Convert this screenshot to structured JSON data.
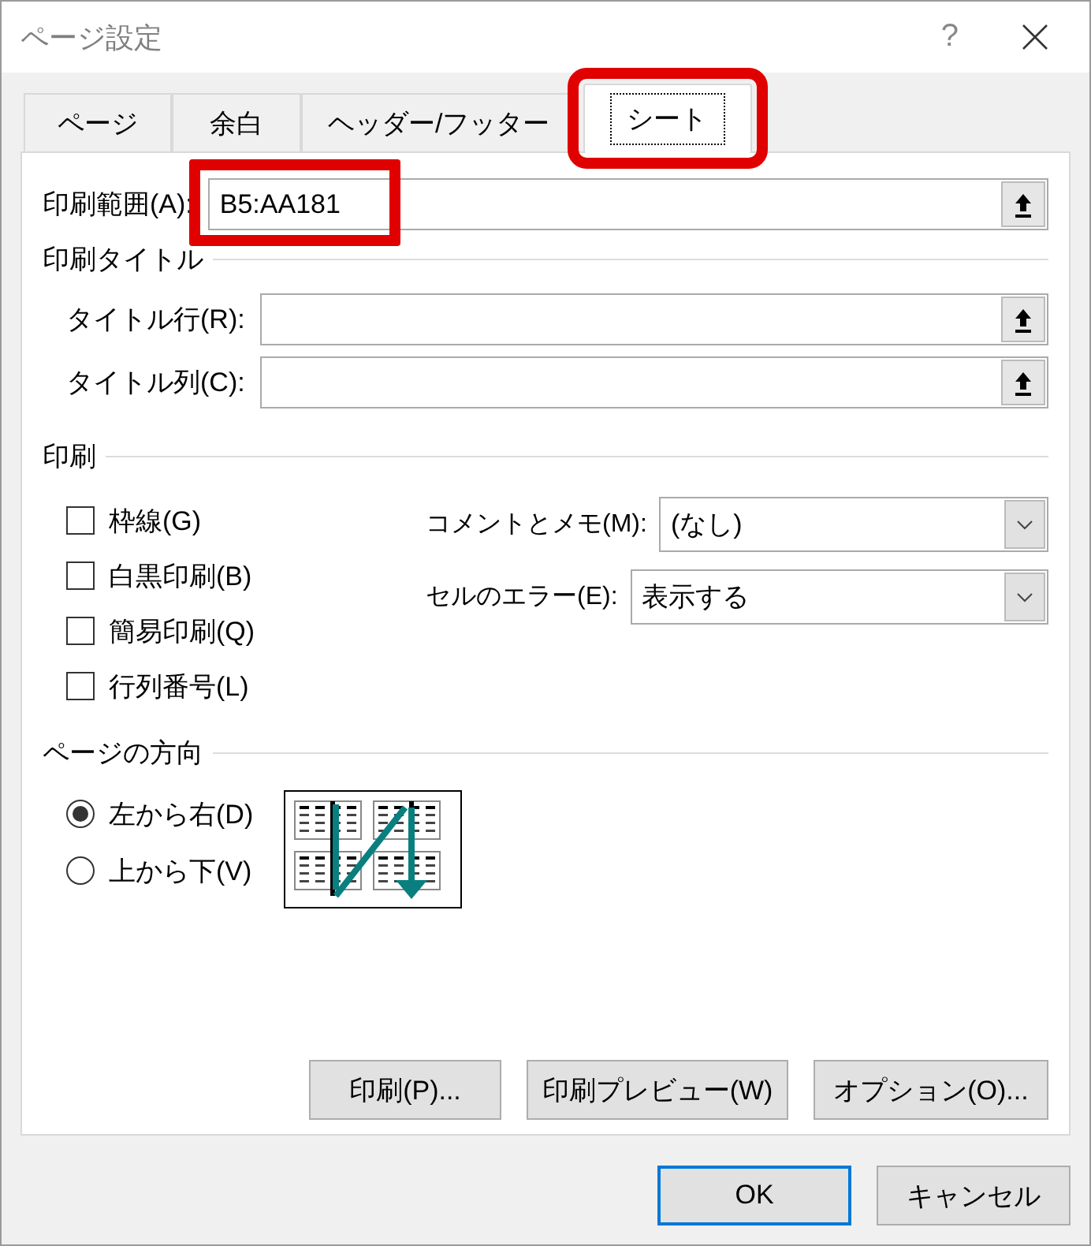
{
  "window": {
    "title": "ページ設定",
    "help": "?"
  },
  "tabs": [
    {
      "label": "ページ",
      "selected": false,
      "highlighted": false
    },
    {
      "label": "余白",
      "selected": false,
      "highlighted": false
    },
    {
      "label": "ヘッダー/フッター",
      "selected": false,
      "highlighted": false
    },
    {
      "label": "シート",
      "selected": true,
      "highlighted": true
    }
  ],
  "print_area": {
    "label": "印刷範囲(A):",
    "value": "B5:AA181",
    "highlighted": true
  },
  "print_titles": {
    "heading": "印刷タイトル",
    "fields": [
      {
        "label": "タイトル行(R):"
      },
      {
        "label": "タイトル列(C):"
      }
    ]
  },
  "print": {
    "heading": "印刷",
    "options": [
      {
        "label": "枠線(G)",
        "checked": false
      },
      {
        "label": "白黒印刷(B)",
        "checked": false
      },
      {
        "label": "簡易印刷(Q)",
        "checked": false
      },
      {
        "label": "行列番号(L)",
        "checked": false
      }
    ],
    "dropdowns": [
      {
        "label": "コメントとメモ(M):",
        "value": "(なし)"
      },
      {
        "label": "セルのエラー(E):",
        "value": "表示する"
      }
    ]
  },
  "page_order": {
    "heading": "ページの方向",
    "options": [
      {
        "label": "左から右(D)",
        "selected": true
      },
      {
        "label": "上から下(V)",
        "selected": false
      }
    ]
  },
  "action_buttons": [
    "印刷(P)...",
    "印刷プレビュー(W)",
    "オプション(O)..."
  ],
  "dialog_buttons": [
    {
      "label": "OK",
      "default": true
    },
    {
      "label": "キャンセル",
      "default": false
    }
  ]
}
